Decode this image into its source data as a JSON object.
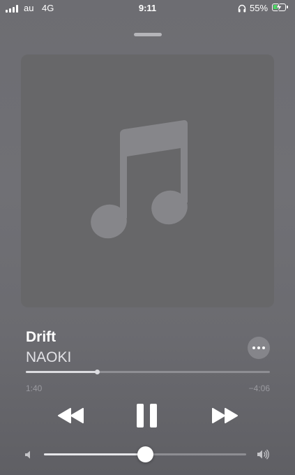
{
  "status_bar": {
    "carrier": "au",
    "network": "4G",
    "time": "9:11",
    "battery_percent": "55%",
    "icons": [
      "signal-bars-icon",
      "headphones-icon",
      "battery-charging-icon"
    ],
    "colors": {
      "battery_fill": "#4cd964"
    }
  },
  "artwork": {
    "icon": "music-note-icon",
    "background": "#676769"
  },
  "track": {
    "title": "Drift",
    "artist": "NAOKI"
  },
  "more_button": {
    "icon": "ellipsis-icon"
  },
  "playback": {
    "elapsed": "1:40",
    "remaining": "−4:06",
    "progress": 0.29
  },
  "controls": {
    "rewind": "rewind-icon",
    "play_pause": "pause-icon",
    "forward": "fast-forward-icon"
  },
  "volume": {
    "level": 0.5,
    "low_icon": "volume-low-icon",
    "high_icon": "volume-high-icon"
  }
}
